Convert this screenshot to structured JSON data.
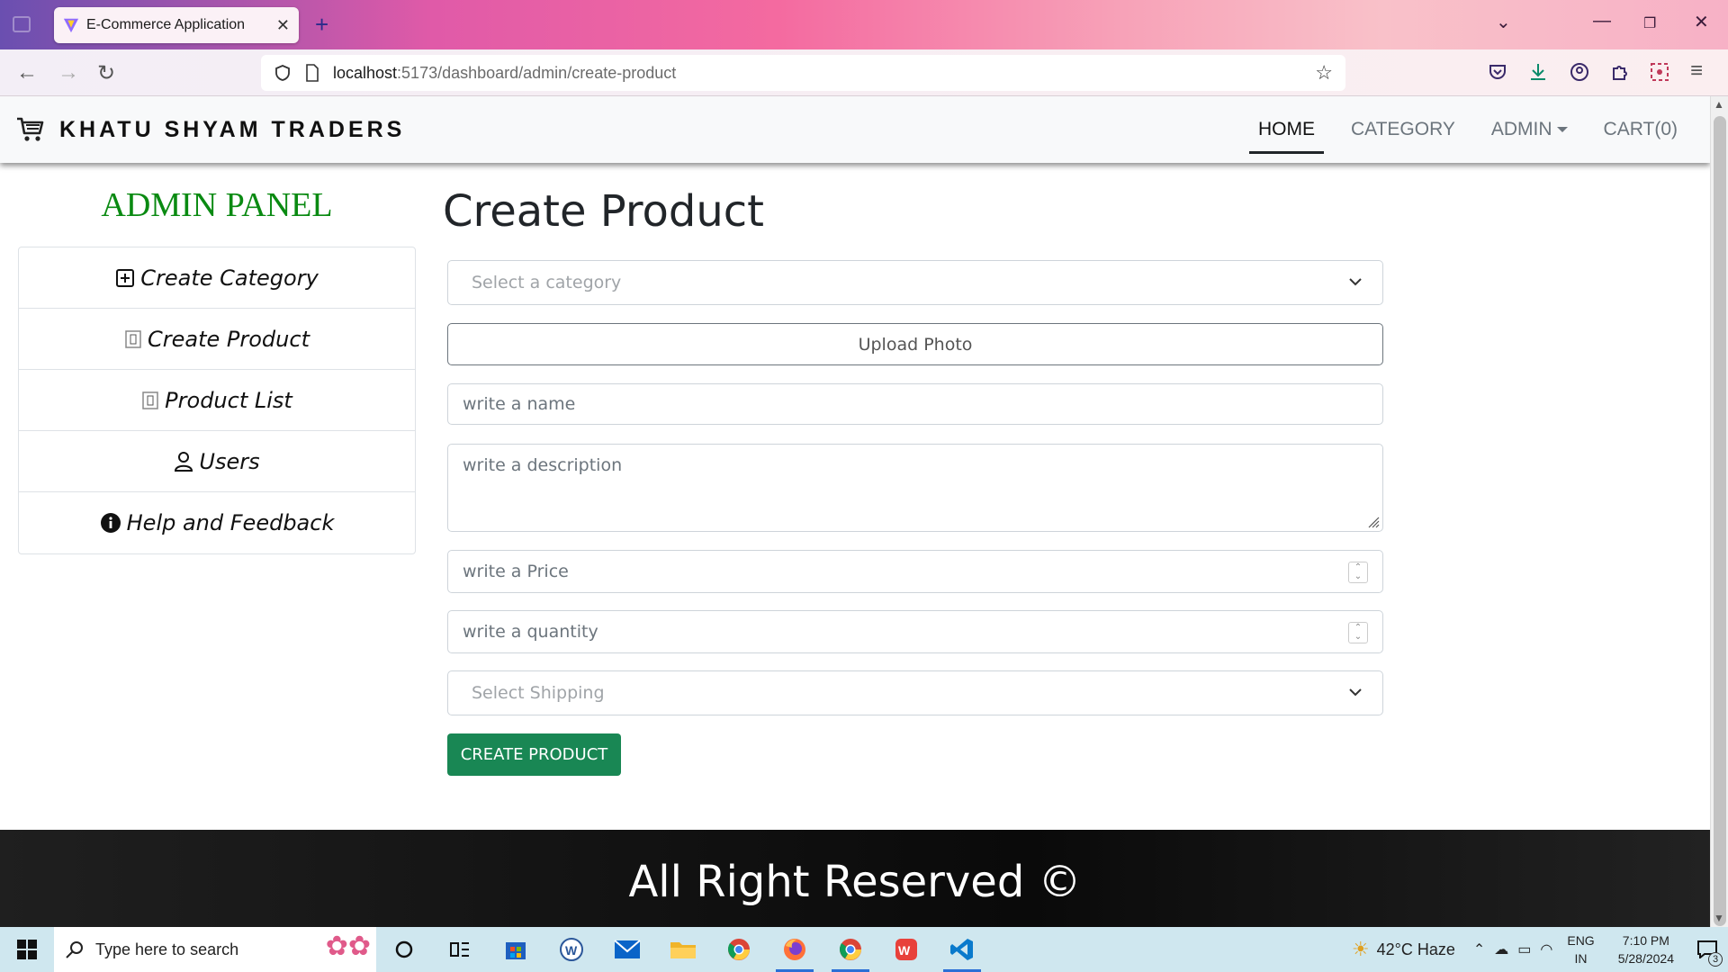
{
  "browser": {
    "tab_title": "E-Commerce Application",
    "url_host": "localhost",
    "url_path": ":5173/dashboard/admin/create-product"
  },
  "header": {
    "brand": "KHATU SHYAM TRADERS",
    "menu": [
      {
        "label": "Home",
        "active": true
      },
      {
        "label": "Category"
      },
      {
        "label": "Admin"
      },
      {
        "label": "Cart(0)"
      }
    ]
  },
  "sidebar": {
    "title": "ADMIN PANEL",
    "items": [
      {
        "label": "Create Category",
        "icon": "plus-square-icon"
      },
      {
        "label": "Create Product",
        "icon": "broken-image-icon"
      },
      {
        "label": "Product List",
        "icon": "broken-image-icon"
      },
      {
        "label": "Users",
        "icon": "user-icon"
      },
      {
        "label": "Help and Feedback",
        "icon": "info-circle-icon"
      }
    ]
  },
  "form": {
    "title": "Create Product",
    "category_placeholder": "Select a category",
    "upload_label": "Upload Photo",
    "name_placeholder": "write a name",
    "description_placeholder": "write a description",
    "price_placeholder": "write a Price",
    "quantity_placeholder": "write a quantity",
    "shipping_placeholder": "Select Shipping",
    "submit_label": "Create Product"
  },
  "footer": {
    "text": "All Right Reserved ©"
  },
  "taskbar": {
    "search_placeholder": "Type here to search",
    "weather": "42°C  Haze",
    "lang_line1": "ENG",
    "lang_line2": "IN",
    "time": "7:10 PM",
    "date": "5/28/2024",
    "notification_count": "3"
  },
  "colors": {
    "admin_title": "#0a8a12",
    "submit_button": "#198754",
    "footer_bg": "#1a1a1a"
  }
}
